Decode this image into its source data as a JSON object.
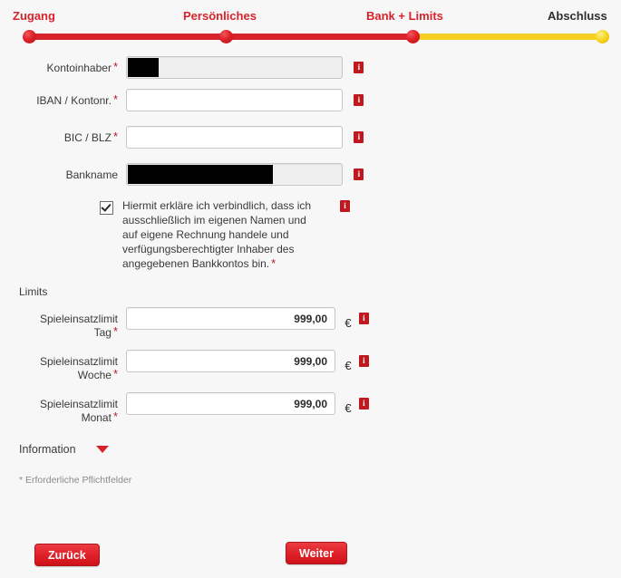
{
  "stepper": {
    "steps": [
      {
        "label": "Zugang",
        "state": "done",
        "dot": "red"
      },
      {
        "label": "Persönliches",
        "state": "done",
        "dot": "red"
      },
      {
        "label": "Bank + Limits",
        "state": "current",
        "dot": "red"
      },
      {
        "label": "Abschluss",
        "state": "todo",
        "dot": "yellow"
      }
    ],
    "colors": {
      "done": "#d7232b",
      "todo": "#f5d021",
      "label_active": "#d7232b",
      "label_inactive": "#2e2e2e"
    }
  },
  "form": {
    "fields": [
      {
        "label": "Kontoinhaber",
        "required": true,
        "value": "",
        "placeholder": "",
        "readonly": true,
        "redacted": "short",
        "info": "i"
      },
      {
        "label": "IBAN / Kontonr.",
        "required": true,
        "value": "",
        "placeholder": "",
        "readonly": false,
        "redacted": "",
        "info": "i"
      },
      {
        "label": "BIC / BLZ",
        "required": true,
        "value": "",
        "placeholder": "",
        "readonly": false,
        "redacted": "",
        "info": "i"
      },
      {
        "label": "Bankname",
        "required": false,
        "value": "",
        "placeholder": "",
        "readonly": true,
        "redacted": "long",
        "info": "i"
      }
    ],
    "declaration": {
      "checked": true,
      "text": "Hiermit erkläre ich verbindlich, dass ich ausschließlich im eigenen Namen und auf eigene Rechnung handele und verfügungsberechtigter Inhaber des angegebenen Bankkontos bin.",
      "required_mark": "*",
      "info": "i"
    }
  },
  "limits": {
    "section_title": "Limits",
    "currency": "€",
    "fields": [
      {
        "label_line1": "Spieleinsatzlimit",
        "label_line2": "Tag",
        "required": true,
        "value": "999,00",
        "info": "i"
      },
      {
        "label_line1": "Spieleinsatzlimit",
        "label_line2": "Woche",
        "required": true,
        "value": "999,00",
        "info": "i"
      },
      {
        "label_line1": "Spieleinsatzlimit",
        "label_line2": "Monat",
        "required": true,
        "value": "999,00",
        "info": "i"
      }
    ]
  },
  "information": {
    "label": "Information",
    "expanded": false
  },
  "footnote": "* Erforderliche Pflichtfelder",
  "buttons": {
    "back_label": "Zurück",
    "next_label": "Weiter",
    "color": "#e02129"
  },
  "required_marker": "*"
}
